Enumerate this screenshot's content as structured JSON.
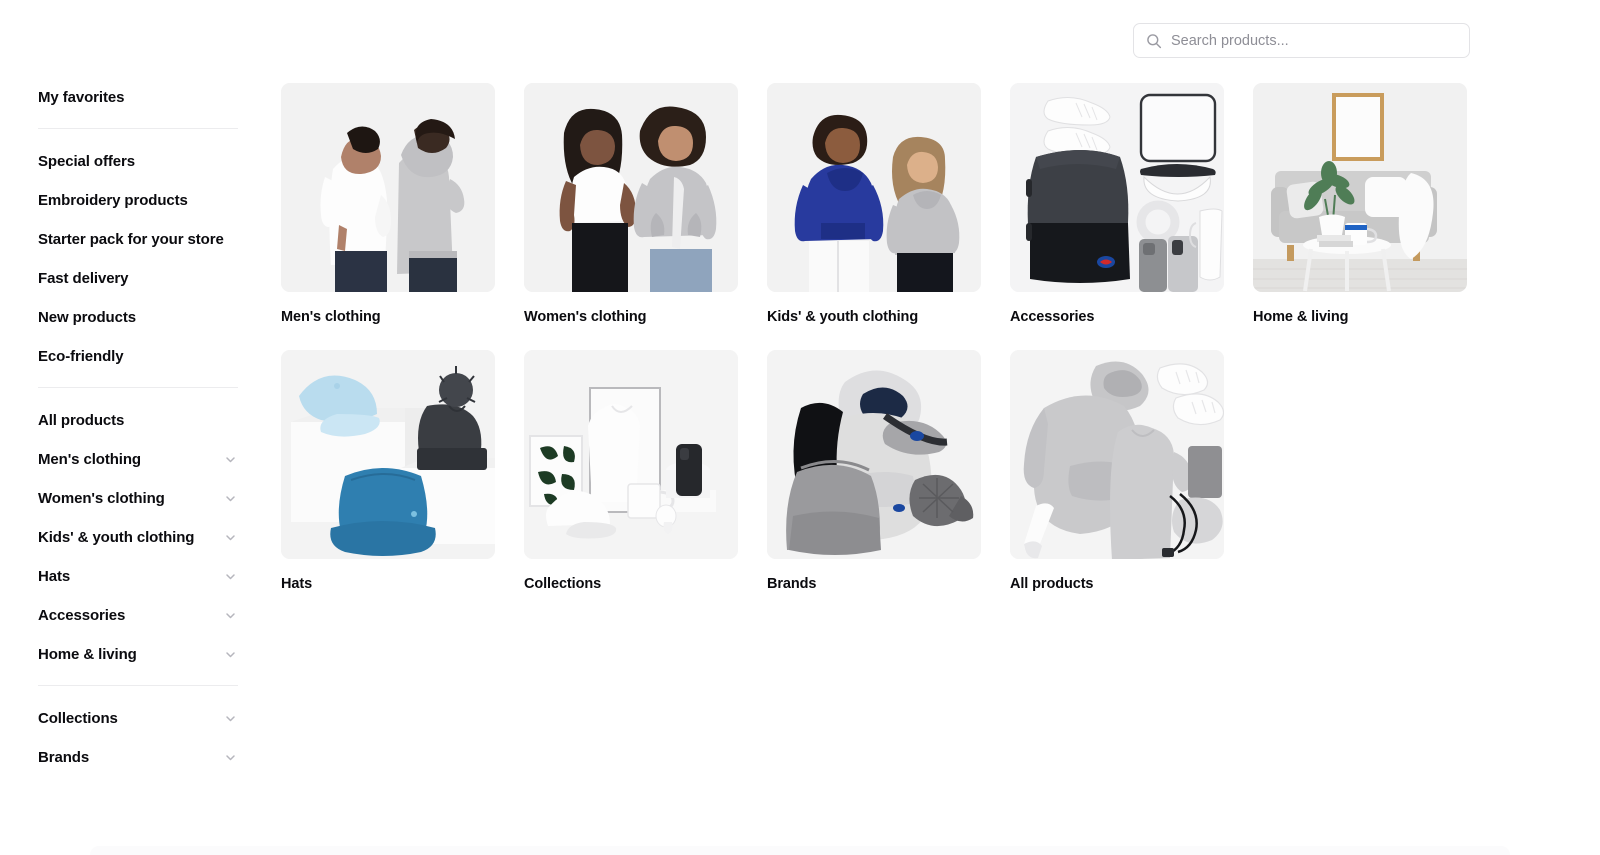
{
  "search": {
    "placeholder": "Search products...",
    "value": "",
    "icon": "search-icon"
  },
  "sidebar": {
    "groups": [
      {
        "id": "favorites",
        "items": [
          {
            "label": "My favorites",
            "expandable": false
          }
        ]
      },
      {
        "id": "promotions",
        "items": [
          {
            "label": "Special offers",
            "expandable": false
          },
          {
            "label": "Embroidery products",
            "expandable": false
          },
          {
            "label": "Starter pack for your store",
            "expandable": false
          },
          {
            "label": "Fast delivery",
            "expandable": false
          },
          {
            "label": "New products",
            "expandable": false
          },
          {
            "label": "Eco-friendly",
            "expandable": false
          }
        ]
      },
      {
        "id": "catalog",
        "items": [
          {
            "label": "All products",
            "expandable": false
          },
          {
            "label": "Men's clothing",
            "expandable": true
          },
          {
            "label": "Women's clothing",
            "expandable": true
          },
          {
            "label": "Kids' & youth clothing",
            "expandable": true
          },
          {
            "label": "Hats",
            "expandable": true
          },
          {
            "label": "Accessories",
            "expandable": true
          },
          {
            "label": "Home & living",
            "expandable": true
          }
        ]
      },
      {
        "id": "browse",
        "items": [
          {
            "label": "Collections",
            "expandable": true
          },
          {
            "label": "Brands",
            "expandable": true
          }
        ]
      }
    ],
    "chevron_icon": "chevron-down-icon"
  },
  "catalog_grid": {
    "rows": [
      [
        {
          "label": "Men's clothing",
          "image": "two-men-white-tshirt-grey-hoodie"
        },
        {
          "label": "Women's clothing",
          "image": "two-women-white-tee-grey-zip-hoodie"
        },
        {
          "label": "Kids' & youth clothing",
          "image": "boy-blue-hoodie-girl-grey-hoodie"
        },
        {
          "label": "Accessories",
          "image": "flatlay-backpack-sneakers-phone-cases-bottle"
        },
        {
          "label": "Home & living",
          "image": "living-room-sofa-framed-poster-plant"
        }
      ],
      [
        {
          "label": "Hats",
          "image": "blue-cap-dark-beanie-denim-bucket-hat"
        },
        {
          "label": "Collections",
          "image": "studio-flatlay-tshirt-mug-cap-phone-poster"
        },
        {
          "label": "Brands",
          "image": "grey-hoodie-backpack-bum-bag-cap"
        },
        {
          "label": "All products",
          "image": "grey-hoodie-tee-sneakers-bottle-drawstring-bag"
        }
      ]
    ]
  },
  "colors": {
    "thumb_background": "#f2f2f2",
    "text_primary": "#0b0b0f",
    "placeholder": "#8e8e96",
    "border": "#e3e3e6",
    "divider": "#ececee"
  }
}
